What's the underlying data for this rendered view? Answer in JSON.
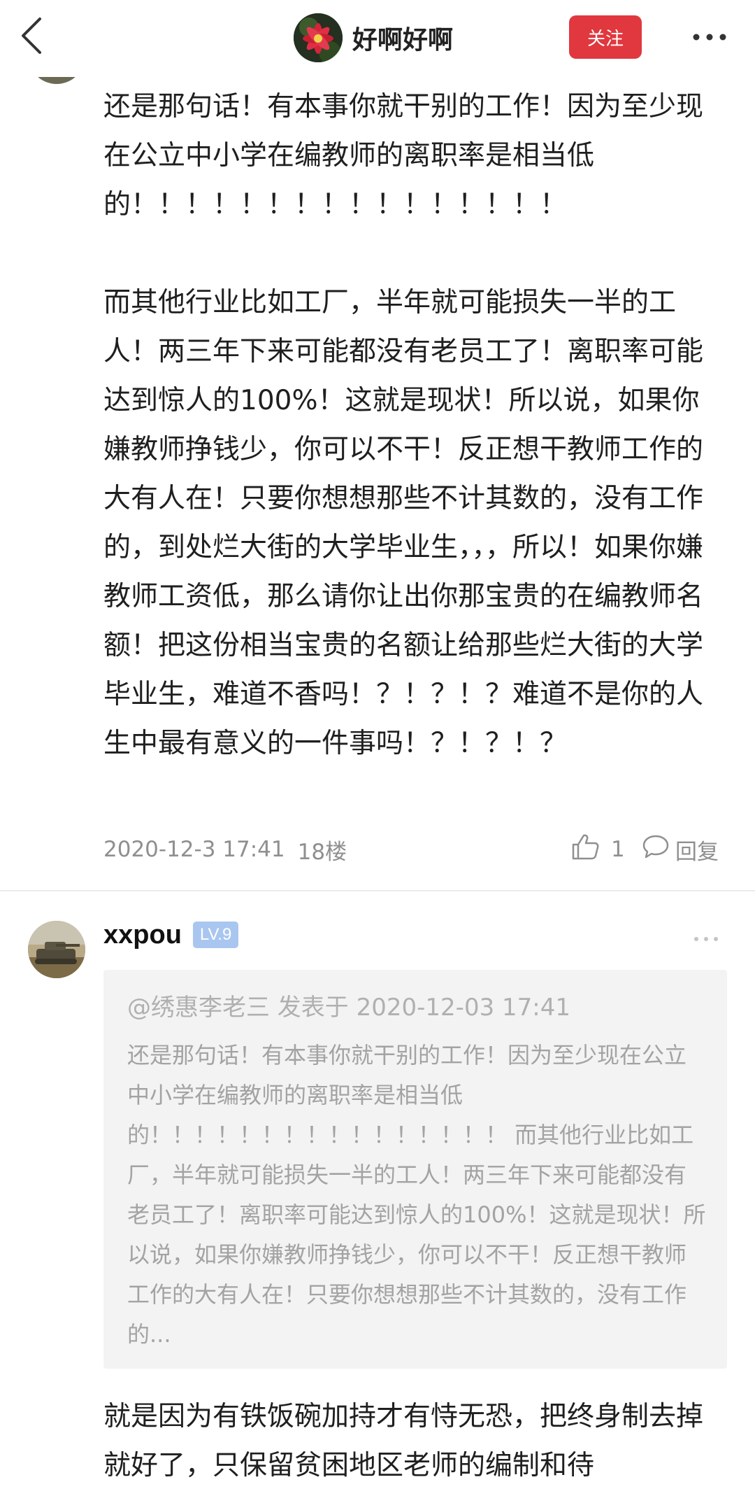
{
  "header": {
    "name": "好啊好啊",
    "follow_label": "关注"
  },
  "post1": {
    "paragraph1": "还是那句话！有本事你就干别的工作！因为至少现在公立中小学在编教师的离职率是相当低的！！！！！！！！！！！！！！！！",
    "paragraph2": "而其他行业比如工厂，半年就可能损失一半的工人！两三年下来可能都没有老员工了！离职率可能达到惊人的100%！这就是现状！所以说，如果你嫌教师挣钱少，你可以不干！反正想干教师工作的大有人在！只要你想想那些不计其数的，没有工作的，到处烂大街的大学毕业生，，，所以！如果你嫌教师工资低，那么请你让出你那宝贵的在编教师名额！把这份相当宝贵的名额让给那些烂大街的大学毕业生，难道不香吗！？！？！？难道不是你的人生中最有意义的一件事吗！？！？！？",
    "time": "2020-12-3 17:41",
    "floor": "18楼",
    "likes": "1",
    "reply_label": "回复"
  },
  "post2": {
    "username": "xxpou",
    "level": "LV.9",
    "quote_header": "@绣惠李老三 发表于 2020-12-03 17:41",
    "quote_text": "还是那句话！有本事你就干别的工作！因为至少现在公立中小学在编教师的离职率是相当低的！！！！！！！！！！！！！！！！ 而其他行业比如工厂，半年就可能损失一半的工人！两三年下来可能都没有老员工了！离职率可能达到惊人的100%！这就是现状！所以说，如果你嫌教师挣钱少，你可以不干！反正想干教师工作的大有人在！只要你想想那些不计其数的，没有工作的...",
    "body": "就是因为有铁饭碗加持才有恃无恐，把终身制去掉就好了，只保留贫困地区老师的编制和待"
  },
  "colors": {
    "follow_button": "#e0383e",
    "level_badge": "#a9c6f0",
    "meta_text": "#8f8f8f",
    "quote_bg": "#f3f3f3"
  },
  "icons": {
    "back": "chevron-left-icon",
    "more": "more-dots-icon",
    "like": "thumbs-up-icon",
    "reply": "comment-bubble-icon"
  }
}
